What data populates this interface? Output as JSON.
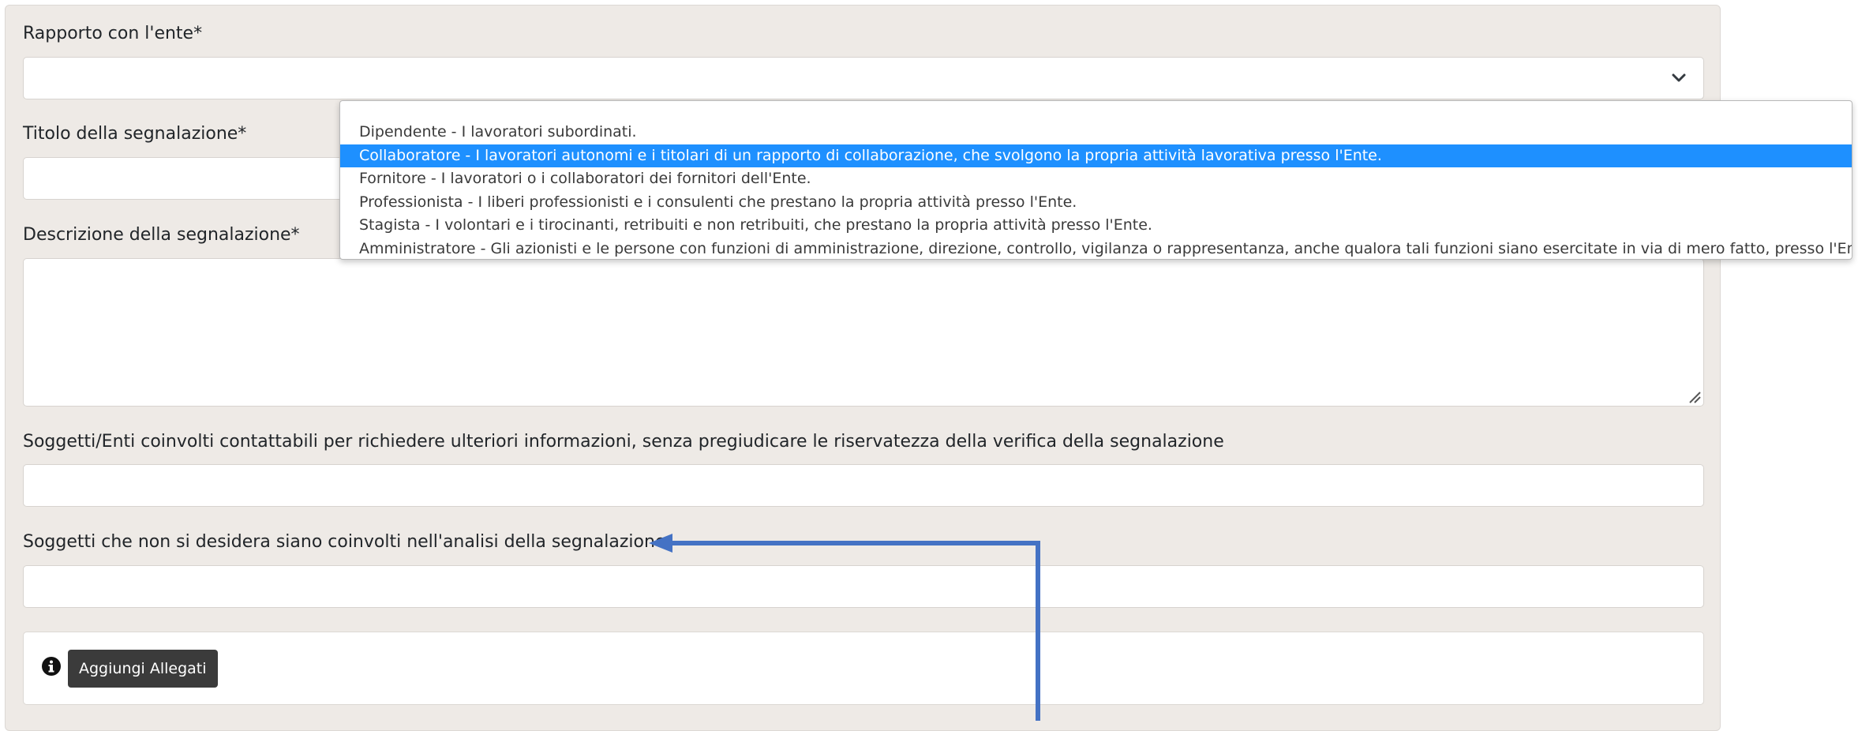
{
  "form": {
    "rapporto_label": "Rapporto con l'ente*",
    "titolo_label": "Titolo della segnalazione*",
    "descrizione_label": "Descrizione della segnalazione*",
    "soggetti_coinvolti_label": "Soggetti/Enti coinvolti contattabili per richiedere ulteriori informazioni, senza pregiudicare le riservatezza della verifica della segnalazione",
    "soggetti_esclusi_label": "Soggetti che non si desidera siano coinvolti nell'analisi della segnalazione",
    "attach_button_label": "Aggiungi Allegati"
  },
  "dropdown": {
    "options": [
      "Dipendente - I lavoratori subordinati.",
      "Collaboratore - I lavoratori autonomi e i titolari di un rapporto di collaborazione, che svolgono la propria attività lavorativa presso l'Ente.",
      "Fornitore - I lavoratori o i collaboratori dei fornitori dell'Ente.",
      "Professionista - I liberi professionisti e i consulenti che prestano la propria attività presso l'Ente.",
      "Stagista - I volontari e i tirocinanti, retribuiti e non retribuiti, che prestano la propria attività presso l'Ente.",
      "Amministratore - Gli azionisti e le persone con funzioni di amministrazione, direzione, controllo, vigilanza o rappresentanza, anche qualora tali funzioni siano esercitate in via di mero fatto, presso l'Ente."
    ],
    "highlighted_index": 1
  },
  "icons": {
    "select_chevron": "chevron-down-icon",
    "info": "info-circle-icon",
    "resize": "resize-grip-icon"
  },
  "colors": {
    "panel_bg": "#eeeae6",
    "highlight": "#1e90ff",
    "button_bg": "#3b3b3b",
    "annotation_arrow": "#4472c4"
  }
}
